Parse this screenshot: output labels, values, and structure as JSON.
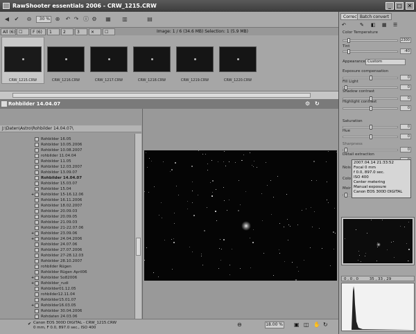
{
  "window": {
    "title": "RawShooter essentials 2006 - CRW_1215.CRW",
    "min": "_",
    "max": "□",
    "close": "✕"
  },
  "toolbar": {
    "zoom": "30 %"
  },
  "thumbtabs": {
    "all": "All (6)",
    "flagged": "F (6)",
    "t2": "2",
    "t3": "3",
    "image_info": "Image: 1 / 6 (34.6 MB) Selection: 1 (5.9 MB)"
  },
  "thumbnails": [
    {
      "label": "CRW_1215.CRW"
    },
    {
      "label": "CRW_1216.CRW"
    },
    {
      "label": "CRW_1217.CRW"
    },
    {
      "label": "CRW_1218.CRW"
    },
    {
      "label": "CRW_1219.CRW"
    },
    {
      "label": "CRW_1220.CRW"
    }
  ],
  "folder": {
    "title": "Rohbilder 14.04.07",
    "path": "J:\\Daten\\Astro\\Rohbilder 14.04.07\\"
  },
  "tree": [
    {
      "label": "Rohbilder 16.05",
      "exp": ""
    },
    {
      "label": "Rohbilder 10.05.2006",
      "exp": ""
    },
    {
      "label": "Rohbilder 10.08.2007",
      "exp": ""
    },
    {
      "label": "rohbilder 11.04.04",
      "exp": ""
    },
    {
      "label": "Rohbilder 11.05",
      "exp": ""
    },
    {
      "label": "Rohbilder 12.03.2007",
      "exp": ""
    },
    {
      "label": "Rohbilder 13.09.07",
      "exp": ""
    },
    {
      "label": "Rohbilder 14.04.07",
      "exp": ""
    },
    {
      "label": "Rohbilder 15.03.07",
      "exp": ""
    },
    {
      "label": "Rohbilder 15.04",
      "exp": ""
    },
    {
      "label": "Rohbilder 15-16.12.06",
      "exp": "+"
    },
    {
      "label": "Rohbilder 16.11.2006",
      "exp": ""
    },
    {
      "label": "Rohbilder 18.02.2007",
      "exp": ""
    },
    {
      "label": "Rohbilder 20.09.03",
      "exp": ""
    },
    {
      "label": "Rohbilder 20.09.05",
      "exp": ""
    },
    {
      "label": "Rohbilder 21.09.03",
      "exp": ""
    },
    {
      "label": "Rohbilder 21-22.07.06",
      "exp": ""
    },
    {
      "label": "Rohbilder 23.09.06",
      "exp": "+"
    },
    {
      "label": "Rohbilder 24.04.2006",
      "exp": "+"
    },
    {
      "label": "Rohbilder 24.07.06",
      "exp": ""
    },
    {
      "label": "Rohbilder 27.07.2006",
      "exp": ""
    },
    {
      "label": "Rohbilder 27-28.12.03",
      "exp": ""
    },
    {
      "label": "Rohbilder 28.10.2007",
      "exp": ""
    },
    {
      "label": "rohbilder Rügen",
      "exp": ""
    },
    {
      "label": "Rohbilder Rügen April06",
      "exp": ""
    },
    {
      "label": "Rohbilder So82006",
      "exp": "+"
    },
    {
      "label": "Rohbilder_rudi",
      "exp": "+"
    },
    {
      "label": "Rohbilder01.12.05",
      "exp": ""
    },
    {
      "label": "rohbilder12.11.04",
      "exp": ""
    },
    {
      "label": "Rohbilder15.01.07",
      "exp": ""
    },
    {
      "label": "Rohbilder16.03.05",
      "exp": "+"
    },
    {
      "label": "Rohbilder 30.04.2006",
      "exp": ""
    },
    {
      "label": "Rohdaten 24.03.06",
      "exp": ""
    },
    {
      "label": "Rohbilder 28.12.06",
      "exp": ""
    }
  ],
  "status": {
    "line1": "Canon EOS 300D DIGITAL - CRW_1215.CRW",
    "line2": "0 mm, F 0.0, 897.0 sec., ISO 400",
    "zoom": "18.00 %"
  },
  "panel": {
    "tab_correct": "Correct",
    "tab_batch": "Batch convert",
    "color_temperature": "Color Temperature",
    "ct_value": "2300",
    "tint": "Tint",
    "tint_value": "-40",
    "appearance": "Appearance",
    "appearance_value": "Custom",
    "exposure": "Exposure compensation",
    "exposure_value": "0",
    "fill_light": "Fill Light",
    "fill_value": "0",
    "shadow": "Shadow contrast",
    "shadow_value": "0",
    "highlight": "Highlight contrast",
    "highlight_value": "0",
    "saturation": "Saturation",
    "saturation_value": "0",
    "hue": "Hue",
    "hue_value": "0",
    "sharpness": "Sharpness",
    "sharpness_value": "0",
    "detail": "Detail extraction",
    "detail_value": "0",
    "noise": "Nois",
    "color": "Colo",
    "moire": "Moir"
  },
  "tooltip": [
    "2007.04.14 21:33:52",
    "Focal 0 mm",
    "f 0.0, 897.0 sec.",
    "ISO 400",
    "Center metering",
    "Manual exposure",
    "Canon EOS 300D DIGITAL"
  ],
  "rgb": {
    "r": "0 , 0 , 0",
    "rhs": "35 , 33 , 29"
  }
}
